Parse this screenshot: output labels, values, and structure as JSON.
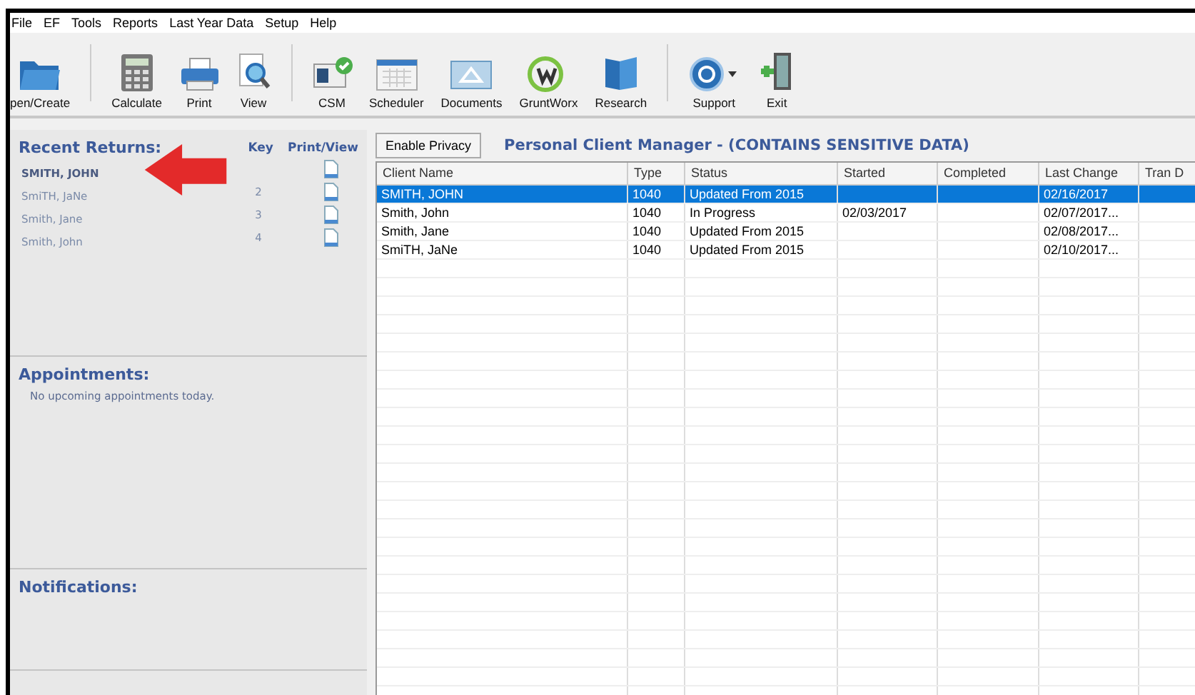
{
  "menu": [
    "File",
    "EF",
    "Tools",
    "Reports",
    "Last Year Data",
    "Setup",
    "Help"
  ],
  "toolbar": [
    {
      "label": "pen/Create",
      "kind": "folder"
    },
    {
      "label": "Calculate",
      "kind": "calculator"
    },
    {
      "label": "Print",
      "kind": "printer"
    },
    {
      "label": "View",
      "kind": "magnifier"
    },
    {
      "label": "CSM",
      "kind": "card"
    },
    {
      "label": "Scheduler",
      "kind": "calendar"
    },
    {
      "label": "Documents",
      "kind": "docs"
    },
    {
      "label": "GruntWorx",
      "kind": "gw"
    },
    {
      "label": "Research",
      "kind": "books"
    },
    {
      "label": "Support",
      "kind": "help"
    },
    {
      "label": "Exit",
      "kind": "exit"
    }
  ],
  "recent_returns": {
    "title": "Recent Returns:",
    "key_heading": "Key",
    "print_heading": "Print/View",
    "items": [
      {
        "name": "SMITH, JOHN",
        "selected": true
      },
      {
        "name": "SmiTH, JaNe",
        "key": "2",
        "selected": false
      },
      {
        "name": "Smith, Jane",
        "key": "3",
        "selected": false
      },
      {
        "name": "Smith, John",
        "key": "4",
        "selected": false
      }
    ]
  },
  "appointments": {
    "title": "Appointments:",
    "text": "No upcoming appointments today."
  },
  "notifications": {
    "title": "Notifications:"
  },
  "privacy_button": "Enable Privacy",
  "manager_title": "Personal Client Manager - (CONTAINS SENSITIVE DATA)",
  "table": {
    "columns": [
      "Client Name",
      "Type",
      "Status",
      "Started",
      "Completed",
      "Last Change",
      "Tran D"
    ],
    "rows": [
      {
        "cells": [
          "SMITH, JOHN",
          "1040",
          "Updated From 2015",
          "",
          "",
          "02/16/2017",
          ""
        ],
        "selected": true
      },
      {
        "cells": [
          "Smith, John",
          "1040",
          "In Progress",
          "02/03/2017",
          "",
          "02/07/2017...",
          ""
        ],
        "selected": false
      },
      {
        "cells": [
          "Smith, Jane",
          "1040",
          "Updated From 2015",
          "",
          "",
          "02/08/2017...",
          ""
        ],
        "selected": false
      },
      {
        "cells": [
          "SmiTH, JaNe",
          "1040",
          "Updated From 2015",
          "",
          "",
          "02/10/2017...",
          ""
        ],
        "selected": false
      }
    ]
  }
}
